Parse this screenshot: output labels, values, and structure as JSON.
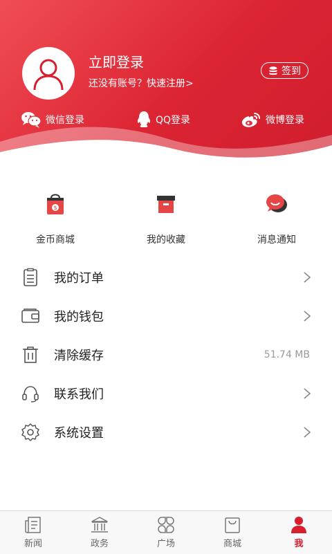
{
  "header": {
    "login_title": "立即登录",
    "register_text": "还没有账号？快速注册>",
    "signin_label": "签到",
    "social": [
      {
        "label": "微信登录",
        "icon": "wechat-icon"
      },
      {
        "label": "QQ登录",
        "icon": "qq-icon"
      },
      {
        "label": "微博登录",
        "icon": "weibo-icon"
      }
    ]
  },
  "quick_actions": [
    {
      "label": "金币商城",
      "icon": "shopping-bag-icon"
    },
    {
      "label": "我的收藏",
      "icon": "favorites-box-icon"
    },
    {
      "label": "消息通知",
      "icon": "message-bubble-icon"
    }
  ],
  "menu": [
    {
      "label": "我的订单",
      "icon": "order-list-icon",
      "value": ""
    },
    {
      "label": "我的钱包",
      "icon": "wallet-icon",
      "value": ""
    },
    {
      "label": "清除缓存",
      "icon": "trash-icon",
      "value": "51.74 MB"
    },
    {
      "label": "联系我们",
      "icon": "headset-icon",
      "value": ""
    },
    {
      "label": "系统设置",
      "icon": "settings-gear-icon",
      "value": ""
    }
  ],
  "tabbar": [
    {
      "label": "新闻",
      "icon": "news-icon"
    },
    {
      "label": "政务",
      "icon": "government-icon"
    },
    {
      "label": "广场",
      "icon": "square-grid-icon"
    },
    {
      "label": "商城",
      "icon": "mall-bag-icon"
    },
    {
      "label": "我",
      "icon": "user-icon",
      "active": true
    }
  ],
  "colors": {
    "accent": "#d81e2c",
    "header_start": "#f04d55",
    "header_end": "#cf1d2c"
  }
}
